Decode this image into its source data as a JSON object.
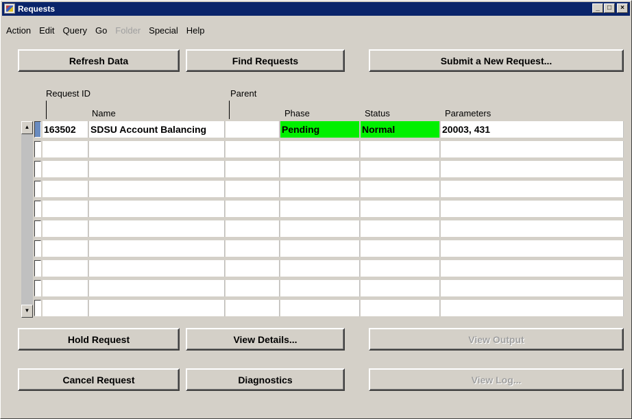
{
  "window": {
    "title": "Requests"
  },
  "menu": [
    "Action",
    "Edit",
    "Query",
    "Go",
    "Folder",
    "Special",
    "Help"
  ],
  "menu_disabled": [
    "Folder"
  ],
  "top_buttons": {
    "refresh": "Refresh Data",
    "find": "Find Requests",
    "submit": "Submit a New Request..."
  },
  "columns": {
    "request_id": "Request ID",
    "name": "Name",
    "parent": "Parent",
    "phase": "Phase",
    "status": "Status",
    "parameters": "Parameters"
  },
  "rows": [
    {
      "request_id": "163502",
      "name": "SDSU Account Balancing",
      "parent": "",
      "phase": "Pending",
      "status": "Normal",
      "parameters": "20003, 431"
    }
  ],
  "empty_rows": 9,
  "colors": {
    "phase_pending": "#00f000",
    "status_normal": "#00f000",
    "title_bar": "#0a246a",
    "current_row_indicator": "#6a8cc0"
  },
  "bottom_buttons": {
    "hold": "Hold Request",
    "view_details": "View Details...",
    "view_output": "View Output",
    "cancel": "Cancel Request",
    "diagnostics": "Diagnostics",
    "view_log": "View Log..."
  }
}
